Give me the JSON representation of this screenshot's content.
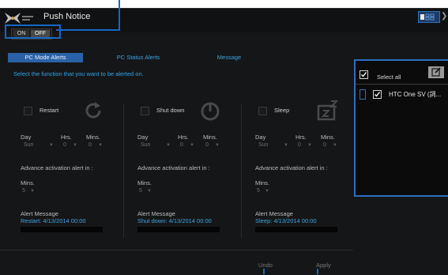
{
  "window": {
    "title": "Push Notice"
  },
  "toggle": {
    "on_label": "ON",
    "off_label": "OFF"
  },
  "tabs": [
    {
      "label": "PC Mode Alerts",
      "active": true
    },
    {
      "label": "PC Status Alerts",
      "active": false
    },
    {
      "label": "Message",
      "active": false
    }
  ],
  "hint": "Select the function that you want to be alerted on.",
  "labels": {
    "day": "Day",
    "hrs": "Hrs.",
    "mins": "Mins.",
    "advance": "Advance activation alert in :",
    "adv_mins": "Mins.",
    "alert_message": "Alert Message"
  },
  "functions": [
    {
      "name": "Restart",
      "day": "Sun",
      "hrs": "0",
      "mins": "0",
      "advance_mins": "5",
      "message": "Restart: 4/13/2014 00:00",
      "icon": "restart-icon"
    },
    {
      "name": "Shut down",
      "day": "Sun",
      "hrs": "0",
      "mins": "0",
      "advance_mins": "5",
      "message": "Shut down: 4/13/2014 00:00",
      "icon": "power-icon"
    },
    {
      "name": "Sleep",
      "day": "Sun",
      "hrs": "0",
      "mins": "0",
      "advance_mins": "5",
      "message": "Sleep: 4/13/2014 00:00",
      "icon": "sleep-icon"
    }
  ],
  "buttons": {
    "undo": "Undo",
    "apply": "Apply"
  },
  "devices": {
    "select_all": "Select all",
    "items": [
      {
        "name": "HTC One SV (詞..."
      }
    ]
  },
  "colors": {
    "accent": "#2b62a7",
    "link": "#3aa6e8",
    "annotation": "#1668c6"
  }
}
